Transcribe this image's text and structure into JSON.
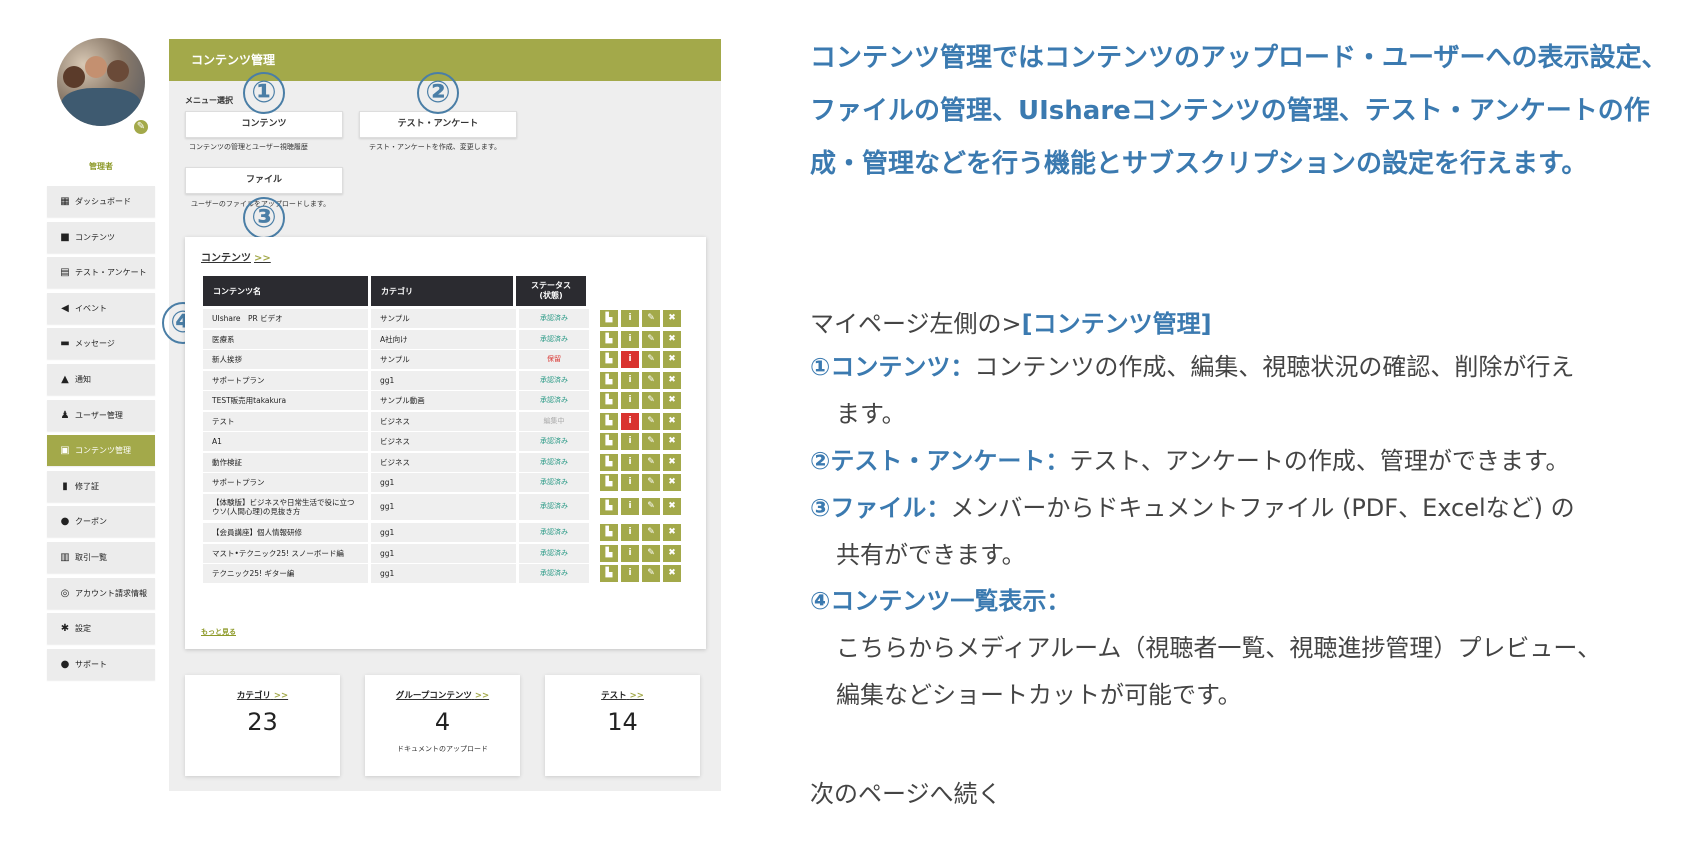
{
  "sidebar": {
    "role": "管理者",
    "items": [
      {
        "label": "ダッシュボード",
        "icon": "▦"
      },
      {
        "label": "コンテンツ",
        "icon": "■"
      },
      {
        "label": "テスト・アンケート",
        "icon": "▤"
      },
      {
        "label": "イベント",
        "icon": "◀"
      },
      {
        "label": "メッセージ",
        "icon": "▬"
      },
      {
        "label": "通知",
        "icon": "▲"
      },
      {
        "label": "ユーザー管理",
        "icon": "♟"
      },
      {
        "label": "コンテンツ管理",
        "icon": "▣"
      },
      {
        "label": "修了証",
        "icon": "▮"
      },
      {
        "label": "クーポン",
        "icon": "●"
      },
      {
        "label": "取引一覧",
        "icon": "▥"
      },
      {
        "label": "アカウント請求情報",
        "icon": "◎"
      },
      {
        "label": "設定",
        "icon": "✱"
      },
      {
        "label": "サポート",
        "icon": "●"
      }
    ]
  },
  "panel": {
    "title": "コンテンツ管理",
    "menu_label": "メニュー選択",
    "cards": [
      {
        "label": "コンテンツ",
        "desc": "コンテンツの管理とユーザー視聴履歴"
      },
      {
        "label": "テスト・アンケート",
        "desc": "テスト・アンケートを作成、変更します。"
      },
      {
        "label": "ファイル",
        "desc": "ユーザーのファイルをアップロードします。"
      }
    ],
    "markers": [
      "①",
      "②",
      "③",
      "④"
    ],
    "contents": {
      "title": "コンテンツ",
      "arrow": ">>",
      "headers": {
        "name": "コンテンツ名",
        "category": "カテゴリ",
        "status": "ステータス\n(状態)"
      },
      "rows": [
        {
          "name": "UIshare　PR ビデオ",
          "category": "サンプル",
          "status": "承認済み"
        },
        {
          "name": "医療系",
          "category": "A社向け",
          "status": "承認済み"
        },
        {
          "name": "新人挨拶",
          "category": "サンプル",
          "status": "保留"
        },
        {
          "name": "サポートプラン",
          "category": "gg1",
          "status": "承認済み"
        },
        {
          "name": "TEST販売用takakura",
          "category": "サンプル動画",
          "status": "承認済み"
        },
        {
          "name": "テスト",
          "category": "ビジネス",
          "status": "編集中"
        },
        {
          "name": "A1",
          "category": "ビジネス",
          "status": "承認済み"
        },
        {
          "name": "動作検証",
          "category": "ビジネス",
          "status": "承認済み"
        },
        {
          "name": "サポートプラン",
          "category": "gg1",
          "status": "承認済み"
        },
        {
          "name": "【体験版】ビジネスや日常生活で役に立つ　ウソ(人間心理)の見抜き方",
          "category": "gg1",
          "status": "承認済み"
        },
        {
          "name": "【会員講座】個人情報研修",
          "category": "gg1",
          "status": "承認済み"
        },
        {
          "name": "マスト•テクニック25! スノーボード編",
          "category": "gg1",
          "status": "承認済み"
        },
        {
          "name": "テクニック25! ギター編",
          "category": "gg1",
          "status": "承認済み"
        }
      ],
      "more": "もっと見る"
    },
    "stats": [
      {
        "title": "カテゴリ",
        "arrow": ">>",
        "value": "23",
        "sub": ""
      },
      {
        "title": "グループコンテンツ",
        "arrow": ">>",
        "value": "4",
        "sub": "ドキュメントのアップロード"
      },
      {
        "title": "テスト",
        "arrow": ">>",
        "value": "14",
        "sub": ""
      }
    ]
  },
  "colors": {
    "accent": "#a3a94a",
    "blue": "#3b7ab0",
    "danger": "#d9332f",
    "approved": "#2a9a86",
    "pending": "#d9332f",
    "editing": "#aaaaaa"
  },
  "text": {
    "headline": "コンテンツ管理ではコンテンツのアップロード・ユーザーへの表示設定、ファイルの管理、UIshareコンテンツの管理、テスト・アンケートの作成・管理などを行う機能とサブスクリプションの設定を行えます。",
    "intro_prefix": "マイページ左側の>",
    "intro_key": "[コンテンツ管理]",
    "f1_key": "①コンテンツ：",
    "f1_text": "コンテンツの作成、編集、視聴状況の確認、削除が行え",
    "f1_cont": "ます。",
    "f2_key": "②テスト・アンケート：",
    "f2_text": "テスト、アンケートの作成、管理ができます。",
    "f3_key": "③ファイル：",
    "f3_text": "メンバーからドキュメントファイル (PDF、Excelなど) の",
    "f3_cont": "共有ができます。",
    "f4_key": "④コンテンツ一覧表示：",
    "f4_cont1": "こちらからメディアルーム（視聴者一覧、視聴進捗管理）プレビュー、",
    "f4_cont2": "編集などショートカットが可能です。",
    "next": "次のページへ続く"
  }
}
